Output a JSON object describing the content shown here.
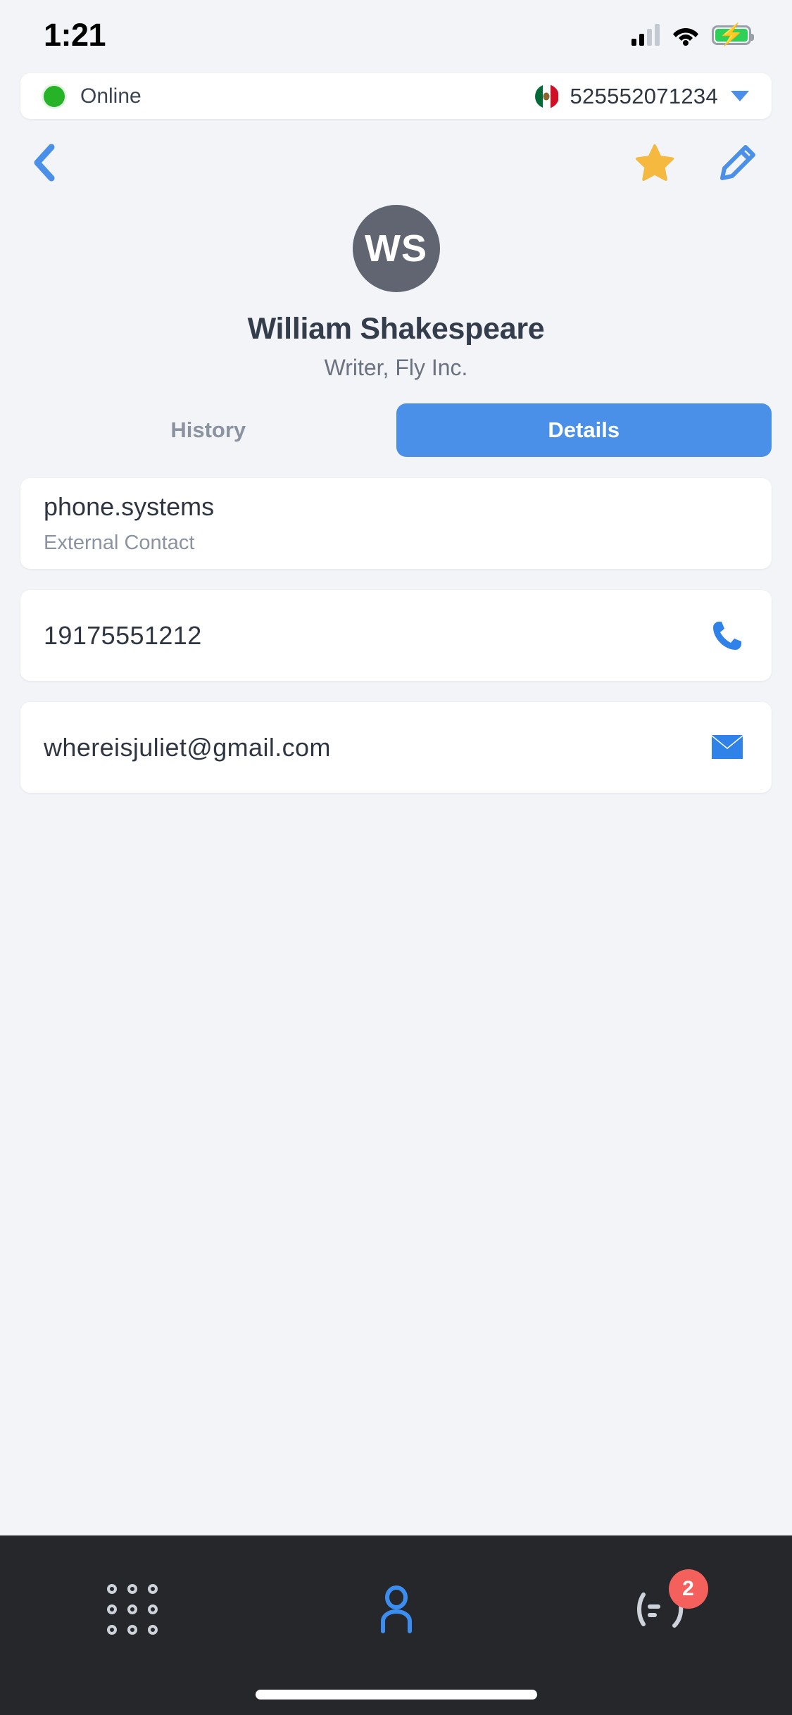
{
  "status_bar": {
    "time": "1:21",
    "cellular_icon": "signal-bars-icon",
    "wifi_icon": "wifi-icon",
    "battery_icon": "battery-charging-icon",
    "battery_color": "#2FD058",
    "signal_bars_filled": 2,
    "signal_bars_total": 4
  },
  "account_bar": {
    "presence_label": "Online",
    "presence_color": "#27B327",
    "country_flag": "mexico-flag-icon",
    "phone_number": "525552071234",
    "dropdown_icon": "chevron-down-icon",
    "dropdown_color": "#4A90E8"
  },
  "nav": {
    "back_icon": "back-chevron-icon",
    "back_color": "#4A90E8",
    "favorite_icon": "star-filled-icon",
    "favorite_color": "#F5B940",
    "edit_icon": "pencil-icon",
    "edit_color": "#4A90E8"
  },
  "profile": {
    "initials": "WS",
    "avatar_color": "#616572",
    "name": "William Shakespeare",
    "subtitle": "Writer, Fly Inc."
  },
  "tabs": [
    {
      "label": "History",
      "active": false
    },
    {
      "label": "Details",
      "active": true
    }
  ],
  "accent_color": "#4A90E8",
  "cards": [
    {
      "type": "info",
      "title": "phone.systems",
      "subtitle": "External Contact"
    },
    {
      "type": "phone",
      "value": "19175551212",
      "action_icon": "phone-call-icon",
      "action_color": "#2E82E8"
    },
    {
      "type": "email",
      "value": "whereisjuliet@gmail.com",
      "action_icon": "envelope-icon",
      "action_color": "#2E82E8"
    }
  ],
  "bottom_nav": {
    "background": "#25272B",
    "items": [
      {
        "icon": "dialpad-icon",
        "active": false,
        "color": "#CED2DA"
      },
      {
        "icon": "contacts-person-icon",
        "active": true,
        "color": "#3B8EF0"
      },
      {
        "icon": "call-history-icon",
        "active": false,
        "color": "#CED2DA",
        "badge": "2",
        "badge_color": "#F4605C"
      }
    ]
  }
}
